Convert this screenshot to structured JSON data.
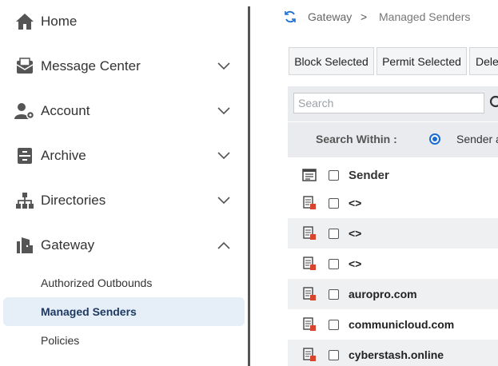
{
  "sidebar": {
    "items": [
      {
        "label": "Home",
        "icon": "home-icon"
      },
      {
        "label": "Message Center",
        "icon": "message-center-icon"
      },
      {
        "label": "Account",
        "icon": "account-settings-icon"
      },
      {
        "label": "Archive",
        "icon": "archive-icon"
      },
      {
        "label": "Directories",
        "icon": "directories-icon"
      },
      {
        "label": "Gateway",
        "icon": "gateway-icon"
      }
    ],
    "gateway_sub": [
      {
        "label": "Authorized Outbounds"
      },
      {
        "label": "Managed Senders"
      },
      {
        "label": "Policies"
      }
    ]
  },
  "breadcrumb": {
    "parent": "Gateway",
    "separator": ">",
    "current": "Managed Senders"
  },
  "toolbar": {
    "block_label": "Block Selected",
    "permit_label": "Permit Selected",
    "delete_label": "Dele"
  },
  "search": {
    "placeholder": "Search",
    "within_label": "Search Within :",
    "within_option": "Sender a"
  },
  "table": {
    "header": "Sender",
    "rows": [
      {
        "sender": "<>"
      },
      {
        "sender": "<>"
      },
      {
        "sender": "<>"
      },
      {
        "sender": "auropro.com"
      },
      {
        "sender": "communicloud.com"
      },
      {
        "sender": "cyberstash.online"
      }
    ]
  },
  "colors": {
    "accent": "#1c6dd0",
    "active_bg": "#e6eef8",
    "active_text": "#1f3a60",
    "bar_bg": "#e9ebee"
  }
}
